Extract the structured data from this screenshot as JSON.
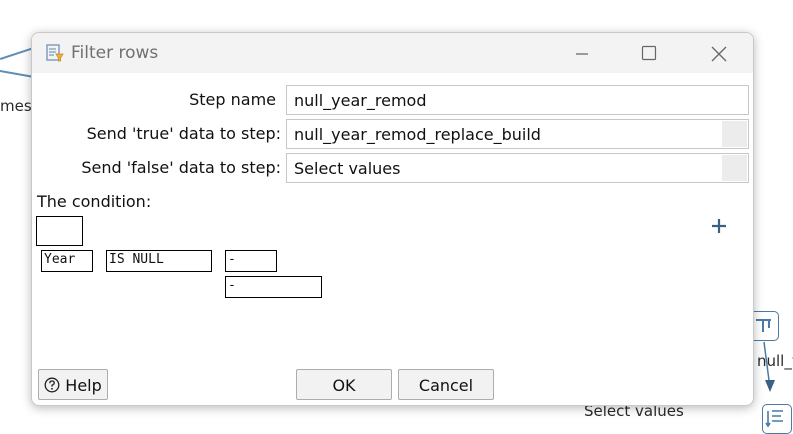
{
  "background": {
    "left_label_fragment": "mesc",
    "right_label_fragment": "null_y",
    "select_values_label": "Select values"
  },
  "dialog": {
    "title": "Filter rows",
    "step_name_label": "Step name",
    "step_name_value": "null_year_remod",
    "true_label": "Send 'true' data to step:",
    "true_value": "null_year_remod_replace_build",
    "false_label": "Send 'false' data to step:",
    "false_value": "Select values",
    "condition_label": "The condition:",
    "condition": {
      "field": "Year",
      "operator": "IS NULL",
      "value1": "-",
      "value2": "-"
    },
    "help_label": "Help",
    "ok_label": "OK",
    "cancel_label": "Cancel"
  },
  "colors": {
    "accent": "#4a7aa5",
    "plus": "#3a6184"
  }
}
